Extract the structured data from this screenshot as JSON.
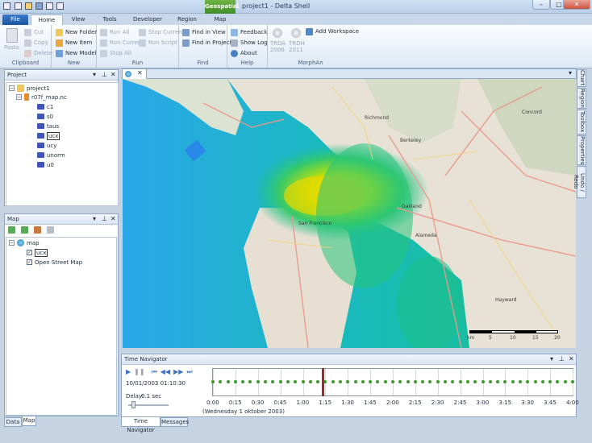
{
  "window": {
    "title": "project1 - Delta Shell",
    "context_tab": "Geospatial"
  },
  "ribbon_tabs": [
    "File",
    "Home",
    "View",
    "Tools",
    "Developer",
    "Region",
    "Map"
  ],
  "ribbon": {
    "clipboard": {
      "label": "Clipboard",
      "paste": "Paste",
      "cut": "Cut",
      "copy": "Copy",
      "delete": "Delete"
    },
    "new": {
      "label": "New",
      "folder": "New Folder",
      "item": "New Item",
      "model": "New Model"
    },
    "run": {
      "label": "Run",
      "run_all": "Run All",
      "run_current": "Run Current",
      "stop_all": "Stop All",
      "stop_current": "Stop Current",
      "run_script": "Run Script"
    },
    "find": {
      "label": "Find",
      "in_view": "Find in View",
      "in_project": "Find in Project"
    },
    "help": {
      "label": "Help",
      "feedback": "Feedback",
      "show_log": "Show Log",
      "about": "About"
    },
    "morphan": {
      "label": "MorphAn",
      "trda": "TRDA",
      "trda_year": "2006",
      "trdh": "TRDH",
      "trdh_year": "2011",
      "add_workspace": "Add Workspace"
    }
  },
  "project_panel": {
    "title": "Project",
    "tree": {
      "root": "project1",
      "file": "r07f_map.nc",
      "items": [
        "c1",
        "s0",
        "taus",
        "ucx",
        "ucy",
        "unorm",
        "u0"
      ]
    }
  },
  "map_panel": {
    "title": "Map",
    "root": "map",
    "layers": [
      "ucx",
      "Open Street Map"
    ]
  },
  "left_tabs": [
    "Data",
    "Map"
  ],
  "right_tabs": [
    "Chart",
    "Region",
    "Toolbox",
    "Properties",
    "Undo / Redo"
  ],
  "map": {
    "place_labels": [
      "Concord",
      "Richmond",
      "Berkeley",
      "Oakland",
      "San Francisco",
      "Alameda",
      "Hayward"
    ],
    "scale_labels": [
      "km",
      "5",
      "10",
      "15",
      "20"
    ]
  },
  "time_navigator": {
    "title": "Time Navigator",
    "datetime": "10/01/2003 01:10:30",
    "delay_label": "Delay:",
    "delay_value": "0.1 sec",
    "current_fraction": 0.302,
    "ticks": [
      "0:00",
      "0:15",
      "0:30",
      "0:45",
      "1:00",
      "1:15",
      "1:30",
      "1:45",
      "2:00",
      "2:15",
      "2:30",
      "2:45",
      "3:00",
      "3:15",
      "3:30",
      "3:45",
      "4:00"
    ],
    "date_label": "(Wednesday 1 oktober 2003)"
  },
  "bottom_tabs": [
    "Time Navigator",
    "Messages"
  ],
  "colors": {
    "accent": "#1d56a3",
    "geospatial": "#4f9e2f",
    "timeline_marker": "#a0262b",
    "timeline_dot": "#3d9a2e"
  }
}
